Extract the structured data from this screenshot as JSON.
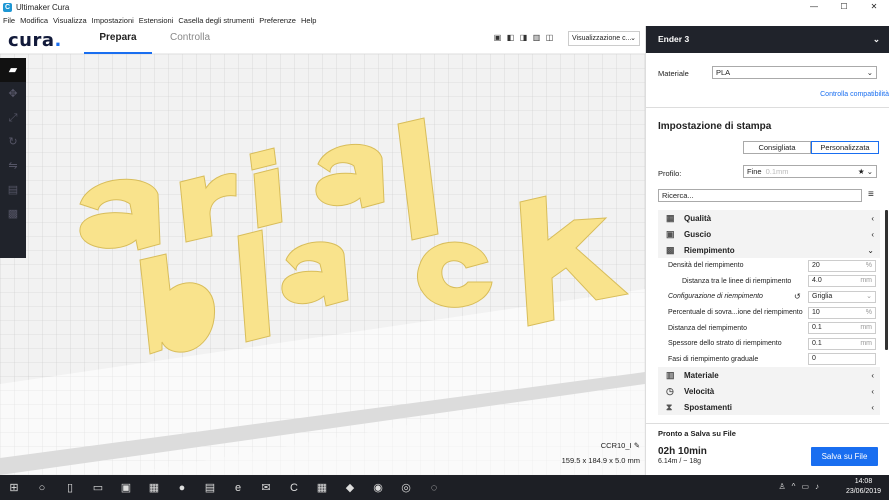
{
  "window": {
    "title": "Ultimaker Cura",
    "controls": [
      "—",
      "☐",
      "✕"
    ]
  },
  "menu": [
    "File",
    "Modifica",
    "Visualizza",
    "Impostazioni",
    "Estensioni",
    "Casella degli strumenti",
    "Preferenze",
    "Help"
  ],
  "header": {
    "logo": "cura",
    "logo_dot": ".",
    "tabs": [
      "Prepara",
      "Controlla"
    ],
    "view_select": "Visualizzazione c...",
    "view_buttons": [
      "▣",
      "◧",
      "◨",
      "▥",
      "◫"
    ]
  },
  "toolbar": {
    "icons": [
      "folder-open-icon",
      "move-icon",
      "scale-icon",
      "rotate-icon",
      "mirror-icon",
      "per-model-settings-icon",
      "support-blocker-icon"
    ]
  },
  "scene": {
    "models": [
      "arial",
      "black"
    ],
    "accent": "#f9e38c"
  },
  "object": {
    "name": "CCR10_I",
    "dims": "159.5 x 184.9 x 5.0 mm"
  },
  "panel": {
    "printer": "Ender 3",
    "material_label": "Materiale",
    "material_value": "PLA",
    "compat_link": "Controlla compatibilità",
    "print_settings_title": "Impostazione di stampa",
    "mode_recommended": "Consigliata",
    "mode_custom": "Personalizzata",
    "profile_label": "Profilo:",
    "profile_value": "Fine",
    "profile_sub": "0.1mm",
    "search_placeholder": "Ricerca...",
    "categories_top": [
      "Qualità",
      "Guscio",
      "Riempimento"
    ],
    "infill": [
      {
        "label": "Densità del riempimento",
        "value": "20",
        "unit": "%"
      },
      {
        "label": "Distanza tra le linee di riempimento",
        "value": "4.0",
        "unit": "mm"
      },
      {
        "label": "Configurazione di riempimento",
        "value": "Griglia",
        "unit": "⌄"
      },
      {
        "label": "Percentuale di sovra...ione del riempimento",
        "value": "10",
        "unit": "%"
      },
      {
        "label": "Distanza del riempimento",
        "value": "0.1",
        "unit": "mm"
      },
      {
        "label": "Spessore dello strato di riempimento",
        "value": "0.1",
        "unit": "mm"
      },
      {
        "label": "Fasi di riempimento graduale",
        "value": "0",
        "unit": ""
      }
    ],
    "categories_bottom": [
      "Materiale",
      "Velocità",
      "Spostamenti"
    ]
  },
  "print": {
    "ready": "Pronto a Salva su File",
    "time": "02h 10min",
    "material": "6.14m / ~ 18g",
    "save_button": "Salva su File"
  },
  "taskbar": {
    "time": "14:08",
    "date": "23/06/2019"
  }
}
